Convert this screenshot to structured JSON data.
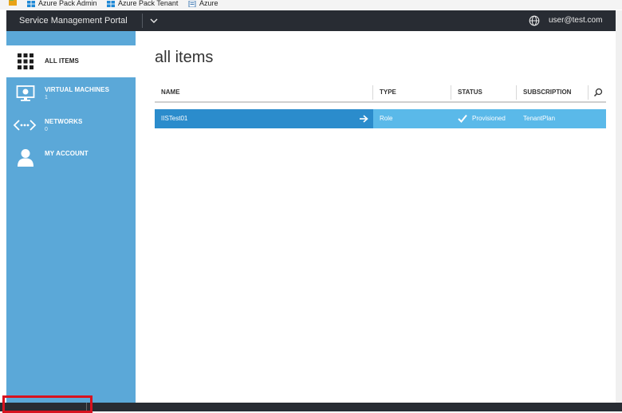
{
  "bookmarks": [
    {
      "label": "Azure Pack Admin",
      "icon": "windows-icon"
    },
    {
      "label": "Azure Pack Tenant",
      "icon": "windows-icon"
    },
    {
      "label": "Azure",
      "icon": "page-icon"
    }
  ],
  "header": {
    "title": "Service Management Portal",
    "user": "user@test.com"
  },
  "sidebar": {
    "items": [
      {
        "label": "ALL ITEMS",
        "count": "",
        "icon": "grid-icon",
        "active": true
      },
      {
        "label": "VIRTUAL MACHINES",
        "count": "1",
        "icon": "monitor-icon",
        "active": false
      },
      {
        "label": "NETWORKS",
        "count": "0",
        "icon": "network-icon",
        "active": false
      },
      {
        "label": "MY ACCOUNT",
        "count": "",
        "icon": "user-icon",
        "active": false
      }
    ]
  },
  "main": {
    "title": "all items",
    "columns": [
      "NAME",
      "TYPE",
      "STATUS",
      "SUBSCRIPTION"
    ],
    "rows": [
      {
        "name": "IISTest01",
        "type": "Role",
        "status": "Provisioned",
        "subscription": "TenantPlan"
      }
    ]
  },
  "colors": {
    "sidebar": "#5ba8d8",
    "topbar": "#282c33",
    "selected_row": "#5ab9e9",
    "selected_name_cell": "#2b8ccc",
    "highlight_box": "#d8121f"
  }
}
